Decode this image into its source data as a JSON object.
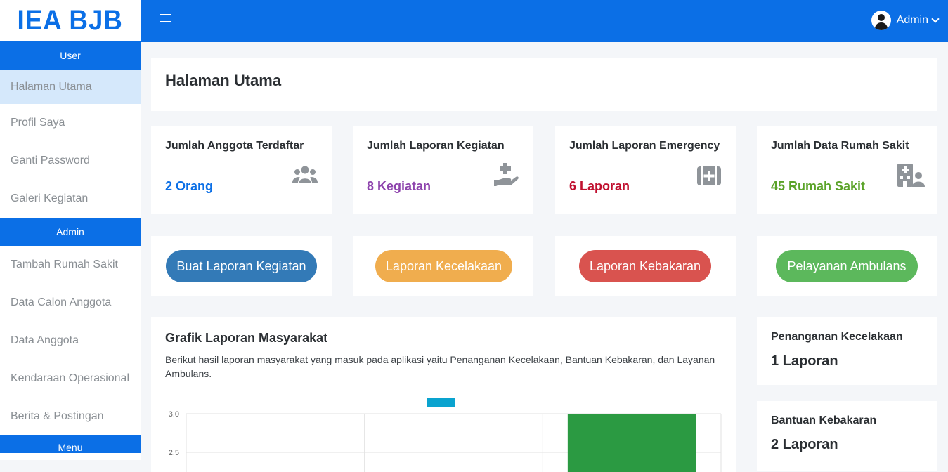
{
  "brand": {
    "name": "IEA BJB",
    "color": "#0b6fe6"
  },
  "sidebar": {
    "sections": [
      {
        "title": "User",
        "items": [
          "Halaman Utama",
          "Profil Saya",
          "Ganti Password",
          "Galeri Kegiatan"
        ]
      },
      {
        "title": "Admin",
        "items": [
          "Tambah Rumah Sakit",
          "Data Calon Anggota",
          "Data Anggota",
          "Kendaraan Operasional",
          "Berita & Postingan"
        ]
      },
      {
        "title": "Menu",
        "items": []
      }
    ],
    "active_item": "Halaman Utama"
  },
  "topbar": {
    "menu_icon": "hamburger-icon",
    "user_name": "Admin",
    "user_icon": "user-circle-icon"
  },
  "page": {
    "title": "Halaman Utama"
  },
  "stats": [
    {
      "label": "Jumlah Anggota Terdaftar",
      "value": "2 Orang",
      "color": "#0b6fe6",
      "icon": "users-icon"
    },
    {
      "label": "Jumlah Laporan Kegiatan",
      "value": "8 Kegiatan",
      "color": "#8e44ad",
      "icon": "hand-holding-medical-icon"
    },
    {
      "label": "Jumlah Laporan Emergency",
      "value": "6 Laporan",
      "color": "#c0102f",
      "icon": "first-aid-kit-icon"
    },
    {
      "label": "Jumlah Data Rumah Sakit",
      "value": "45 Rumah Sakit",
      "color": "#5ba329",
      "icon": "hospital-user-icon"
    }
  ],
  "actions": [
    {
      "label": "Buat Laporan Kegiatan",
      "color": "#337ab7"
    },
    {
      "label": "Laporan Kecelakaan",
      "color": "#f0ad4e"
    },
    {
      "label": "Laporan Kebakaran",
      "color": "#d9534f"
    },
    {
      "label": "Pelayanan Ambulans",
      "color": "#5cb85c"
    }
  ],
  "chart": {
    "title": "Grafik Laporan Masyarakat",
    "description": "Berikut hasil laporan masyarakat yang masuk pada aplikasi yaitu Penanganan Kecelakaan, Bantuan Kebakaran, dan Layanan Ambulans."
  },
  "chart_data": {
    "type": "bar",
    "categories": [
      "",
      "",
      ""
    ],
    "series": [
      {
        "name": "",
        "values": [
          null,
          null,
          3
        ],
        "color": "#2b9a42"
      }
    ],
    "legend_color": "#0aa3cf",
    "legend_placement": "top",
    "y_ticks": [
      "3.0",
      "2.5"
    ],
    "ylim": [
      2.5,
      3.0
    ],
    "grid": true
  },
  "side_stats": [
    {
      "label": "Penanganan Kecelakaan",
      "value": "1 Laporan"
    },
    {
      "label": "Bantuan Kebakaran",
      "value": "2 Laporan"
    }
  ]
}
